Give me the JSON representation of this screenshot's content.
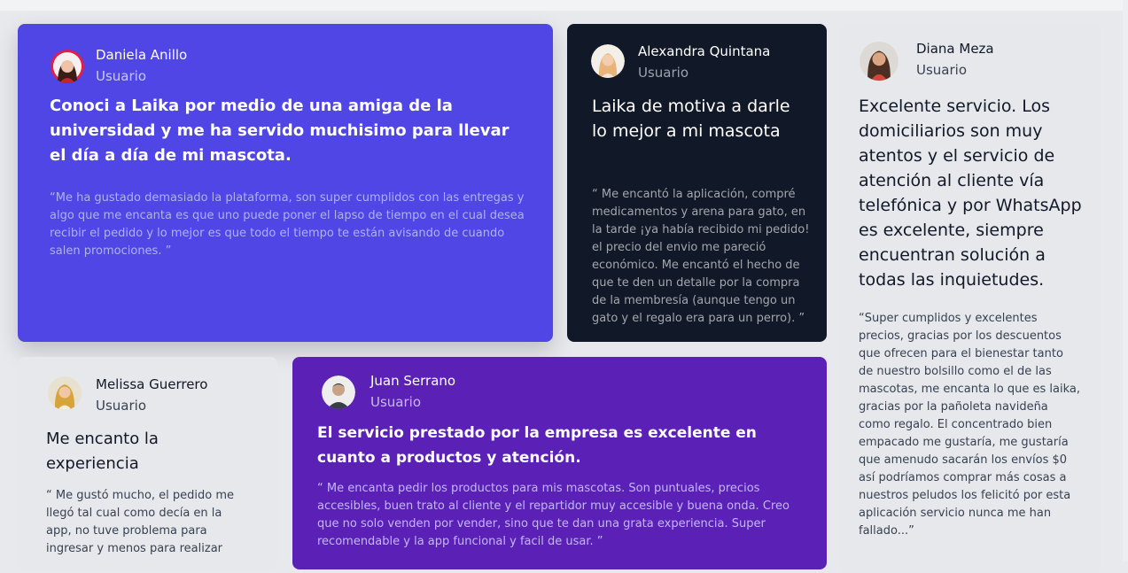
{
  "testimonials": [
    {
      "name": "Daniela Anillo",
      "role": "Usuario",
      "headline": "Conoci a Laika por medio de una amiga de la universidad y me ha servido muchisimo para llevar el día a día de mi mascota.",
      "quote": "“Me ha gustado demasiado la plataforma, son super cumplidos con las entregas y algo que me encanta es que uno puede poner el lapso de tiempo en el cual desea recibir el pedido y lo mejor es que todo el tiempo te están avisando de cuando salen promociones. ”"
    },
    {
      "name": "Alexandra Quintana",
      "role": "Usuario",
      "headline": "Laika de motiva a darle lo mejor a mi mascota",
      "quote": "“ Me encantó la aplicación, compré medicamentos y arena para gato, en la tarde ¡ya había recibido mi pedido! el precio del envio me pareció económico. Me encantó el hecho de que te den un detalle por la compra de la membresía (aunque tengo un gato y el regalo era para un perro). ”"
    },
    {
      "name": "Diana Meza",
      "role": "Usuario",
      "headline": "Excelente servicio. Los domiciliarios son muy atentos y el servicio de atención al cliente vía telefónica y por WhatsApp es excelente, siempre encuentran solución a todas las inquietudes.",
      "quote": "“Super cumplidos y excelentes precios, gracias por los descuentos que ofrecen para el bienestar tanto de nuestro bolsillo como el de las mascotas, me encanta lo que es laika, gracias por la pañoleta navideña como regalo. El concentrado bien empacado me gustaría, me gustaría que amenudo sacarán los envíos $0 así podríamos comprar más cosas a nuestros peludos los felicitó por esta aplicación servicio nunca me han fallado...”"
    },
    {
      "name": "Melissa Guerrero",
      "role": "Usuario",
      "headline": "Me encanto la experiencia",
      "quote": "“ Me gustó mucho, el pedido me llegó tal cual como decía en la app, no tuve problema para ingresar y menos para realizar"
    },
    {
      "name": "Juan Serrano",
      "role": "Usuario",
      "headline": "El servicio prestado por la empresa es excelente en cuanto a productos y atención.",
      "quote": "“ Me encanta pedir los productos para mis mascotas. Son puntuales, precios accesibles, buen trato al cliente y el repartidor muy accesible y buena onda. Creo que no solo venden por vender, sino que te dan una grata experiencia. Super recomendable y la app funcional y facil de usar. ”"
    }
  ],
  "colors": {
    "indigo": "#4f46e5",
    "dark": "#111827",
    "purple": "#5b21b6",
    "light": "#e7e8ec"
  }
}
